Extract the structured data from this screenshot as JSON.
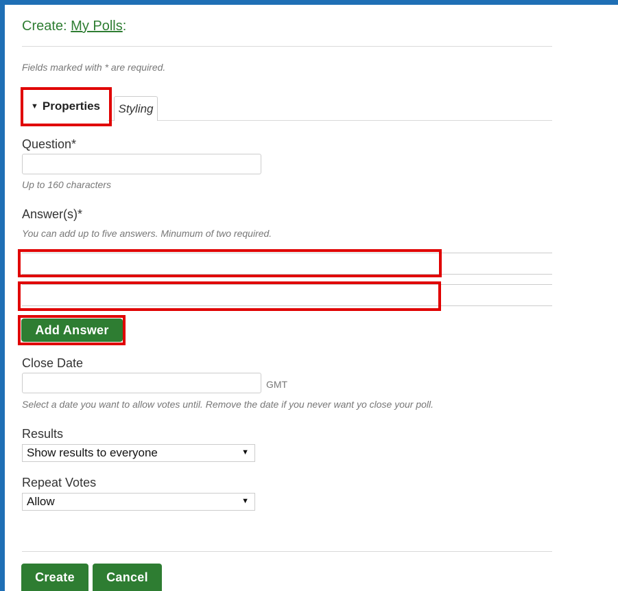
{
  "header": {
    "title_prefix": "Create:",
    "title_link": "My Polls",
    "title_suffix": ":"
  },
  "required_note": "Fields marked with * are required.",
  "tabs": [
    {
      "label": "Properties",
      "active": true
    },
    {
      "label": "Styling",
      "active": false
    }
  ],
  "question": {
    "label": "Question*",
    "value": "",
    "hint": "Up to 160 characters"
  },
  "answers": {
    "label": "Answer(s)*",
    "hint": "You can add up to five answers. Minumum of two required.",
    "values": [
      "",
      ""
    ],
    "add_button": "Add Answer"
  },
  "close_date": {
    "label": "Close Date",
    "value": "",
    "timezone": "GMT",
    "hint": "Select a date you want to allow votes until. Remove the date if you never want yo close your poll."
  },
  "results": {
    "label": "Results",
    "selected": "Show results to everyone"
  },
  "repeat_votes": {
    "label": "Repeat Votes",
    "selected": "Allow"
  },
  "actions": {
    "create": "Create",
    "cancel": "Cancel"
  },
  "colors": {
    "accent_green": "#2e7d32",
    "highlight_red": "#e00000",
    "frame_blue": "#1f6fb5"
  }
}
